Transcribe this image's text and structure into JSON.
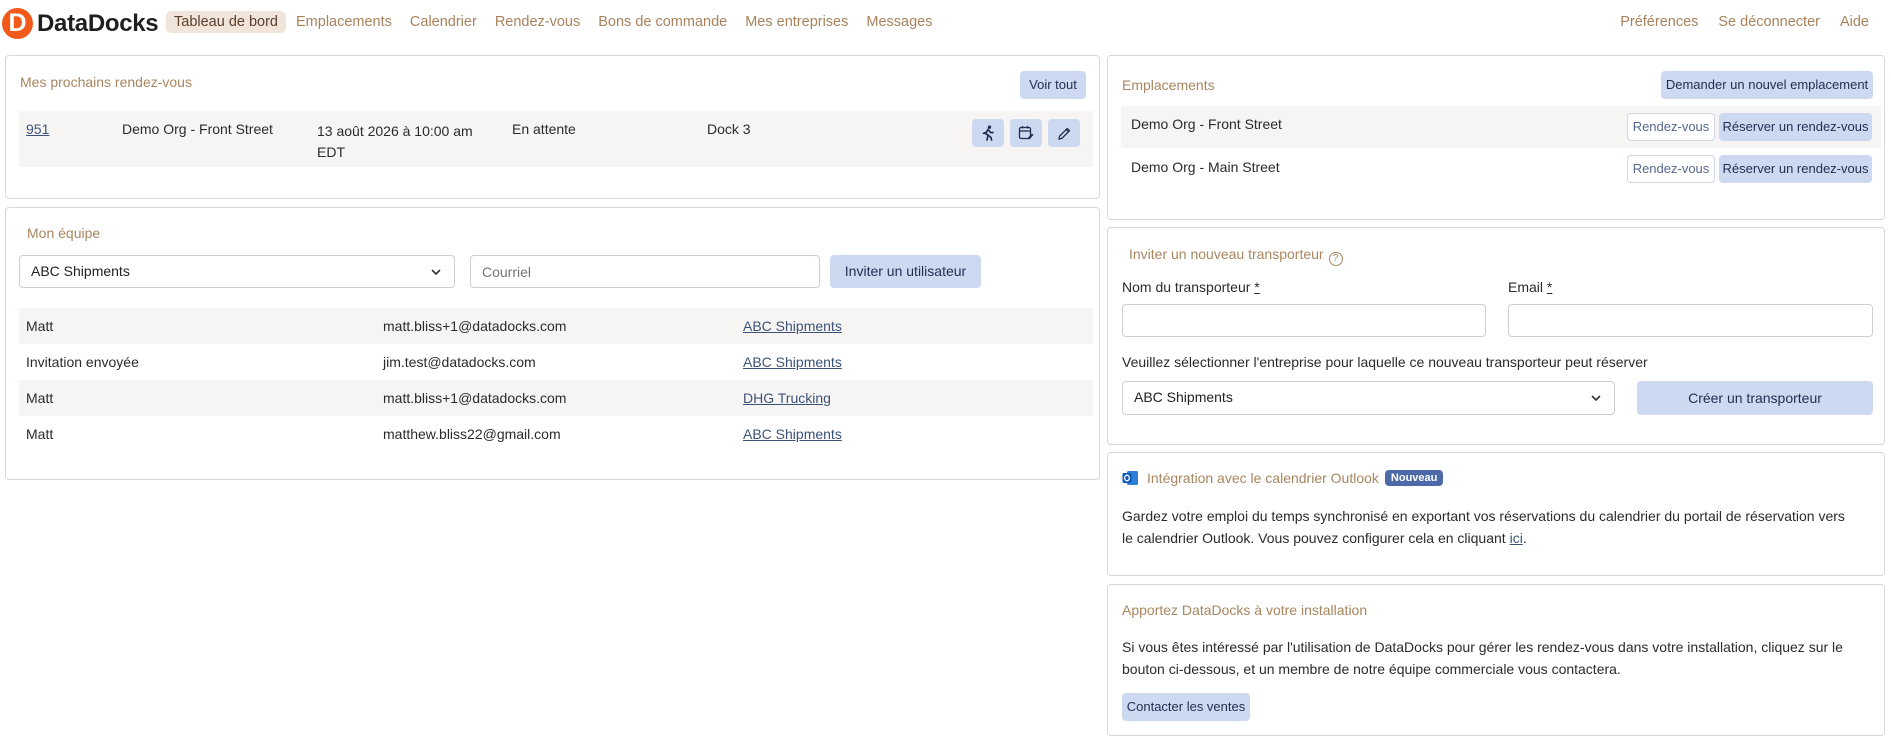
{
  "brand": {
    "name": "DataDocks",
    "mark": "D",
    "color": "#f25a1b"
  },
  "nav": {
    "items": [
      "Tableau de bord",
      "Emplacements",
      "Calendrier",
      "Rendez-vous",
      "Bons de commande",
      "Mes entreprises",
      "Messages"
    ],
    "active": "Tableau de bord",
    "right": [
      "Préférences",
      "Se déconnecter",
      "Aide"
    ]
  },
  "appointments": {
    "title": "Mes prochains rendez-vous",
    "view_all": "Voir tout",
    "row": {
      "id": "951",
      "location": "Demo Org - Front Street",
      "date_line1": "13 août 2026 à 10:00 am",
      "date_line2": "EDT",
      "status": "En attente",
      "dock": "Dock 3",
      "icons": [
        "running-person-icon",
        "calendar-edit-icon",
        "pencil-icon"
      ]
    }
  },
  "team": {
    "title": "Mon équipe",
    "company_select": "ABC Shipments",
    "email_placeholder": "Courriel",
    "invite_button": "Inviter un utilisateur",
    "rows": [
      {
        "name": "Matt",
        "email": "matt.bliss+1@datadocks.com",
        "company": "ABC Shipments"
      },
      {
        "name": "Invitation envoyée",
        "email": "jim.test@datadocks.com",
        "company": "ABC Shipments"
      },
      {
        "name": "Matt",
        "email": "matt.bliss+1@datadocks.com",
        "company": "DHG Trucking"
      },
      {
        "name": "Matt",
        "email": "matthew.bliss22@gmail.com",
        "company": "ABC Shipments"
      }
    ]
  },
  "locations": {
    "title": "Emplacements",
    "request_button": "Demander un nouvel emplacement",
    "items": [
      {
        "name": "Demo Org - Front Street",
        "appointments": "Rendez-vous",
        "book": "Réserver un rendez-vous"
      },
      {
        "name": "Demo Org - Main Street",
        "appointments": "Rendez-vous",
        "book": "Réserver un rendez-vous"
      }
    ]
  },
  "carrier": {
    "title": "Inviter un nouveau transporteur",
    "help": "?",
    "name_label": "Nom du transporteur",
    "email_label": "Email",
    "required_mark": "*",
    "company_prompt": "Veuillez sélectionner l'entreprise pour laquelle ce nouveau transporteur peut réserver",
    "company_select": "ABC Shipments",
    "create_button": "Créer un transporteur"
  },
  "outlook": {
    "title": "Intégration avec le calendrier Outlook",
    "badge": "Nouveau",
    "text_line1": "Gardez votre emploi du temps synchronisé en exportant vos réservations du calendrier du portail de réservation vers",
    "text_line2_before": "le calendrier Outlook. Vous pouvez configurer cela en cliquant ",
    "text_link": "ici",
    "text_after": "."
  },
  "sales": {
    "title": "Apportez DataDocks à votre installation",
    "text_line1": "Si vous êtes intéressé par l'utilisation de DataDocks pour gérer les rendez-vous dans votre installation, cliquez sur le",
    "text_line2": "bouton ci-dessous, et un membre de notre équipe commerciale vous contactera.",
    "button": "Contacter les ventes"
  }
}
